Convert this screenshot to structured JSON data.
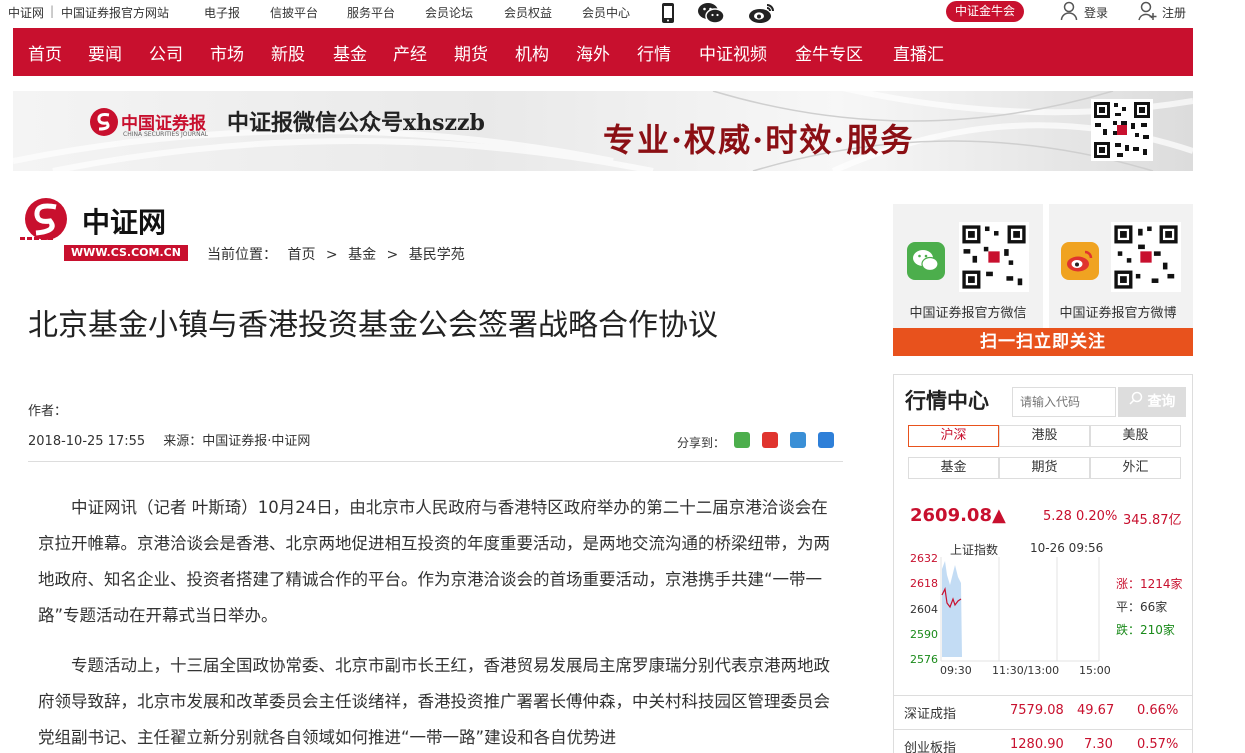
{
  "topbar": {
    "site": "中证网",
    "sep": "|",
    "official": "中国证券报官方网站",
    "links": [
      "电子报",
      "信披平台",
      "服务平台",
      "会员论坛",
      "会员权益",
      "会员中心"
    ],
    "vip": "中证金牛会",
    "login": "登录",
    "register": "注册"
  },
  "nav": [
    "首页",
    "要闻",
    "公司",
    "市场",
    "新股",
    "基金",
    "产经",
    "期货",
    "机构",
    "海外",
    "行情",
    "中证视频",
    "金牛专区",
    "直播汇"
  ],
  "banner": {
    "logo_cn": "中国证券报",
    "logo_en": "CHINA SECURITIES JOURNAL",
    "wechat_text": "中证报微信公众号xhszzb",
    "slogan": "专业·权威·时效·服务"
  },
  "site_logo": {
    "name": "中证网",
    "url": "WWW.CS.COM.CN"
  },
  "breadcrumb": {
    "label": "当前位置：",
    "items": [
      "首页",
      ">",
      "基金",
      ">",
      "基民学苑"
    ]
  },
  "article": {
    "title": "北京基金小镇与香港投资基金公会签署战略合作协议",
    "author": "作者：",
    "date": "2018-10-25 17:55",
    "source": "来源：中国证券报·中证网",
    "share_label": "分享到：",
    "paragraphs": [
      "中证网讯（记者 叶斯琦）10月24日，由北京市人民政府与香港特区政府举办的第二十二届京港洽谈会在京拉开帷幕。京港洽谈会是香港、北京两地促进相互投资的年度重要活动，是两地交流沟通的桥梁纽带，为两地政府、知名企业、投资者搭建了精诚合作的平台。作为京港洽谈会的首场重要活动，京港携手共建“一带一路”专题活动在开幕式当日举办。",
      "专题活动上，十三届全国政协常委、北京市副市长王红，香港贸易发展局主席罗康瑞分别代表京港两地政府领导致辞，北京市发展和改革委员会主任谈绪祥，香港投资推广署署长傅仲森，中关村科技园区管理委员会党组副书记、主任翟立新分别就各自领域如何推进“一带一路”建设和各自优势进"
    ]
  },
  "follow": {
    "wechat_label": "中国证券报官方微信",
    "weibo_label": "中国证券报官方微博",
    "bar": "扫一扫立即关注"
  },
  "market": {
    "title": "行情中心",
    "search_placeholder": "请输入代码",
    "search_button": "查询",
    "tabs_row1": [
      "沪深",
      "港股",
      "美股"
    ],
    "tabs_row2": [
      "基金",
      "期货",
      "外汇"
    ],
    "index_value": "2609.08▲",
    "change": "5.28",
    "change_pct": "0.20%",
    "amount": "345.87亿",
    "chart_title": "上证指数",
    "chart_time": "10-26 09:56",
    "y_ticks": [
      "2632",
      "2618",
      "2604",
      "2590",
      "2576"
    ],
    "x_ticks": [
      "09:30",
      "11:30/13:00",
      "15:00"
    ],
    "up": "涨：1214家",
    "flat": "平：66家",
    "down": "跌：210家",
    "rows": [
      {
        "name": "深证成指",
        "value": "7579.08",
        "change": "49.67",
        "pct": "0.66%"
      },
      {
        "name": "创业板指",
        "value": "1280.90",
        "change": "7.30",
        "pct": "0.57%"
      }
    ],
    "colors": {
      "up": "#c8102e",
      "flat": "#333333",
      "down": "#1a8a1a"
    }
  }
}
